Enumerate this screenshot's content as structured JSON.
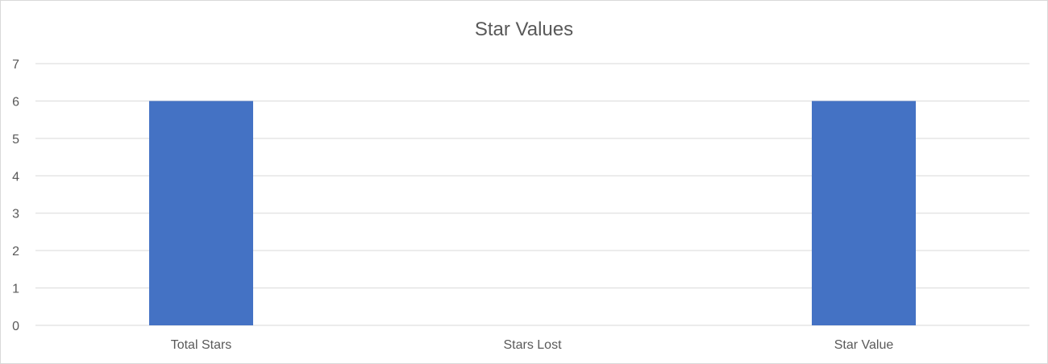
{
  "chart_data": {
    "type": "bar",
    "title": "Star Values",
    "categories": [
      "Total Stars",
      "Stars Lost",
      "Star Value"
    ],
    "series": [
      {
        "values": [
          6,
          0,
          6
        ]
      }
    ],
    "xlabel": "",
    "ylabel": "",
    "ylim": [
      0,
      7
    ],
    "yticks": [
      "0",
      "1",
      "2",
      "3",
      "4",
      "5",
      "6",
      "7"
    ],
    "grid": true,
    "legend": "none",
    "bar_color": "#4472C4",
    "grid_color": "#d9d9d9",
    "text_color": "#595959"
  }
}
